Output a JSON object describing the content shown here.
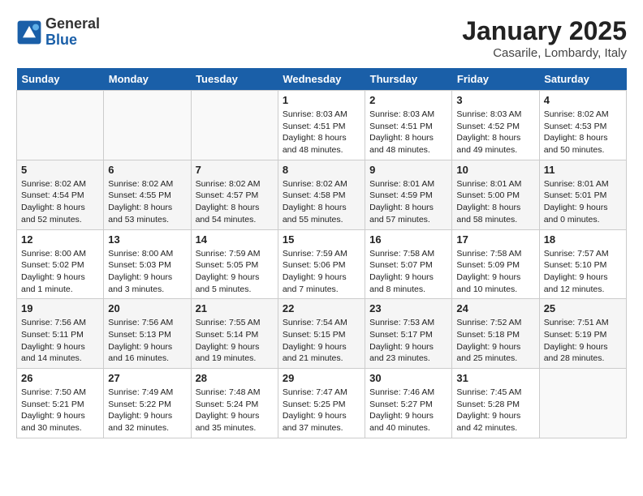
{
  "header": {
    "logo_general": "General",
    "logo_blue": "Blue",
    "month": "January 2025",
    "location": "Casarile, Lombardy, Italy"
  },
  "weekdays": [
    "Sunday",
    "Monday",
    "Tuesday",
    "Wednesday",
    "Thursday",
    "Friday",
    "Saturday"
  ],
  "weeks": [
    [
      {
        "day": "",
        "info": ""
      },
      {
        "day": "",
        "info": ""
      },
      {
        "day": "",
        "info": ""
      },
      {
        "day": "1",
        "info": "Sunrise: 8:03 AM\nSunset: 4:51 PM\nDaylight: 8 hours\nand 48 minutes."
      },
      {
        "day": "2",
        "info": "Sunrise: 8:03 AM\nSunset: 4:51 PM\nDaylight: 8 hours\nand 48 minutes."
      },
      {
        "day": "3",
        "info": "Sunrise: 8:03 AM\nSunset: 4:52 PM\nDaylight: 8 hours\nand 49 minutes."
      },
      {
        "day": "4",
        "info": "Sunrise: 8:02 AM\nSunset: 4:53 PM\nDaylight: 8 hours\nand 50 minutes."
      }
    ],
    [
      {
        "day": "5",
        "info": "Sunrise: 8:02 AM\nSunset: 4:54 PM\nDaylight: 8 hours\nand 52 minutes."
      },
      {
        "day": "6",
        "info": "Sunrise: 8:02 AM\nSunset: 4:55 PM\nDaylight: 8 hours\nand 53 minutes."
      },
      {
        "day": "7",
        "info": "Sunrise: 8:02 AM\nSunset: 4:57 PM\nDaylight: 8 hours\nand 54 minutes."
      },
      {
        "day": "8",
        "info": "Sunrise: 8:02 AM\nSunset: 4:58 PM\nDaylight: 8 hours\nand 55 minutes."
      },
      {
        "day": "9",
        "info": "Sunrise: 8:01 AM\nSunset: 4:59 PM\nDaylight: 8 hours\nand 57 minutes."
      },
      {
        "day": "10",
        "info": "Sunrise: 8:01 AM\nSunset: 5:00 PM\nDaylight: 8 hours\nand 58 minutes."
      },
      {
        "day": "11",
        "info": "Sunrise: 8:01 AM\nSunset: 5:01 PM\nDaylight: 9 hours\nand 0 minutes."
      }
    ],
    [
      {
        "day": "12",
        "info": "Sunrise: 8:00 AM\nSunset: 5:02 PM\nDaylight: 9 hours\nand 1 minute."
      },
      {
        "day": "13",
        "info": "Sunrise: 8:00 AM\nSunset: 5:03 PM\nDaylight: 9 hours\nand 3 minutes."
      },
      {
        "day": "14",
        "info": "Sunrise: 7:59 AM\nSunset: 5:05 PM\nDaylight: 9 hours\nand 5 minutes."
      },
      {
        "day": "15",
        "info": "Sunrise: 7:59 AM\nSunset: 5:06 PM\nDaylight: 9 hours\nand 7 minutes."
      },
      {
        "day": "16",
        "info": "Sunrise: 7:58 AM\nSunset: 5:07 PM\nDaylight: 9 hours\nand 8 minutes."
      },
      {
        "day": "17",
        "info": "Sunrise: 7:58 AM\nSunset: 5:09 PM\nDaylight: 9 hours\nand 10 minutes."
      },
      {
        "day": "18",
        "info": "Sunrise: 7:57 AM\nSunset: 5:10 PM\nDaylight: 9 hours\nand 12 minutes."
      }
    ],
    [
      {
        "day": "19",
        "info": "Sunrise: 7:56 AM\nSunset: 5:11 PM\nDaylight: 9 hours\nand 14 minutes."
      },
      {
        "day": "20",
        "info": "Sunrise: 7:56 AM\nSunset: 5:13 PM\nDaylight: 9 hours\nand 16 minutes."
      },
      {
        "day": "21",
        "info": "Sunrise: 7:55 AM\nSunset: 5:14 PM\nDaylight: 9 hours\nand 19 minutes."
      },
      {
        "day": "22",
        "info": "Sunrise: 7:54 AM\nSunset: 5:15 PM\nDaylight: 9 hours\nand 21 minutes."
      },
      {
        "day": "23",
        "info": "Sunrise: 7:53 AM\nSunset: 5:17 PM\nDaylight: 9 hours\nand 23 minutes."
      },
      {
        "day": "24",
        "info": "Sunrise: 7:52 AM\nSunset: 5:18 PM\nDaylight: 9 hours\nand 25 minutes."
      },
      {
        "day": "25",
        "info": "Sunrise: 7:51 AM\nSunset: 5:19 PM\nDaylight: 9 hours\nand 28 minutes."
      }
    ],
    [
      {
        "day": "26",
        "info": "Sunrise: 7:50 AM\nSunset: 5:21 PM\nDaylight: 9 hours\nand 30 minutes."
      },
      {
        "day": "27",
        "info": "Sunrise: 7:49 AM\nSunset: 5:22 PM\nDaylight: 9 hours\nand 32 minutes."
      },
      {
        "day": "28",
        "info": "Sunrise: 7:48 AM\nSunset: 5:24 PM\nDaylight: 9 hours\nand 35 minutes."
      },
      {
        "day": "29",
        "info": "Sunrise: 7:47 AM\nSunset: 5:25 PM\nDaylight: 9 hours\nand 37 minutes."
      },
      {
        "day": "30",
        "info": "Sunrise: 7:46 AM\nSunset: 5:27 PM\nDaylight: 9 hours\nand 40 minutes."
      },
      {
        "day": "31",
        "info": "Sunrise: 7:45 AM\nSunset: 5:28 PM\nDaylight: 9 hours\nand 42 minutes."
      },
      {
        "day": "",
        "info": ""
      }
    ]
  ]
}
